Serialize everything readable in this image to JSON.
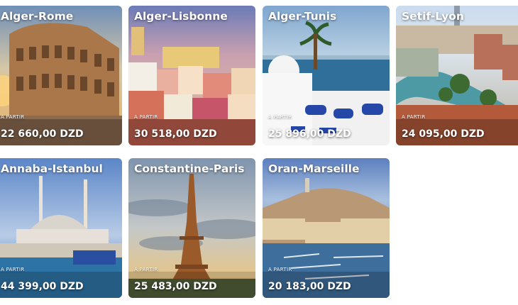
{
  "cards": [
    {
      "title": "Alger-Rome",
      "from": "A PARTIR",
      "price": "22 660,00 DZD",
      "image": "colosseum-sunset"
    },
    {
      "title": "Alger-Lisbonne",
      "from": "A PARTIR",
      "price": "30 518,00 DZD",
      "image": "lisbon-rooftops"
    },
    {
      "title": "Alger-Tunis",
      "from": "A PARTIR",
      "price": "25 896,00 DZD",
      "image": "sidi-bou-said"
    },
    {
      "title": "Setif-Lyon",
      "from": "A PARTIR",
      "price": "24 095,00 DZD",
      "image": "lyon-river"
    },
    {
      "title": "Annaba-Istanbul",
      "from": "A PARTIR",
      "price": "44 399,00 DZD",
      "image": "istanbul-mosque"
    },
    {
      "title": "Constantine-Paris",
      "from": "A PARTIR",
      "price": "25 483,00 DZD",
      "image": "eiffel-tower"
    },
    {
      "title": "Oran-Marseille",
      "from": "A PARTIR",
      "price": "20 183,00 DZD",
      "image": "marseille-port"
    }
  ]
}
